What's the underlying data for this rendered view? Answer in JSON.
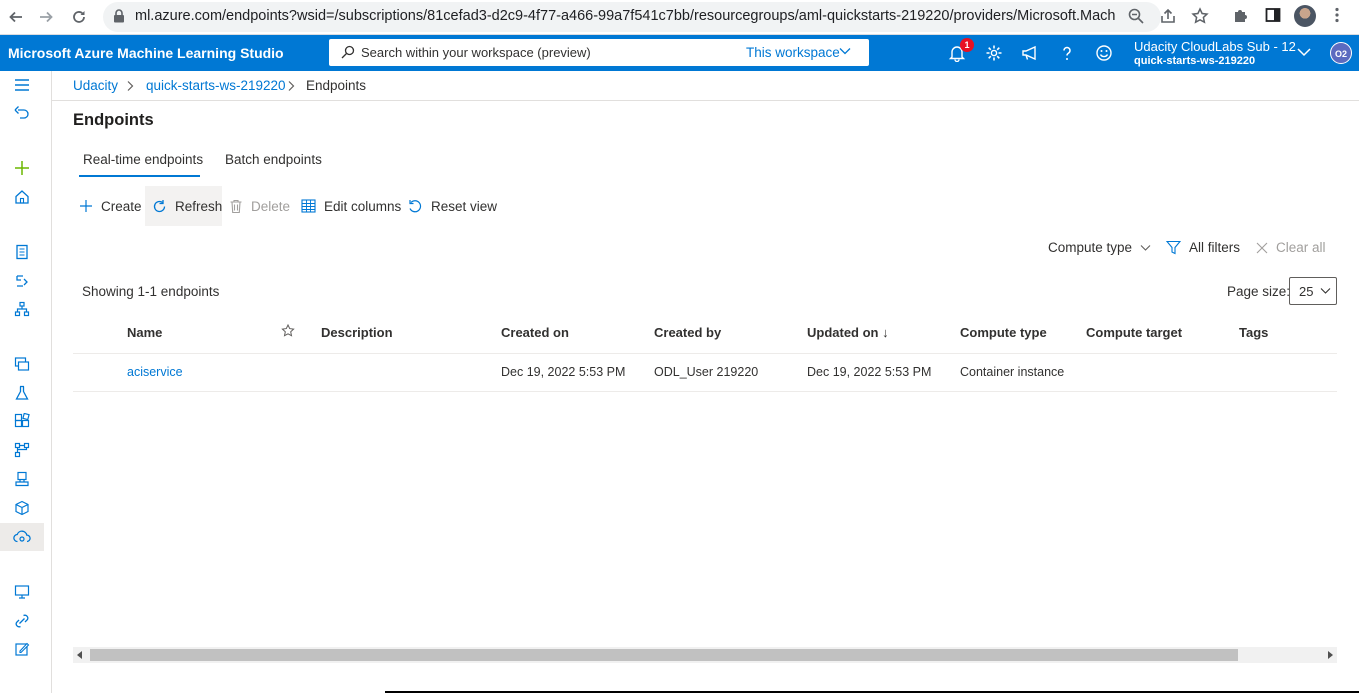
{
  "browser": {
    "url": "ml.azure.com/endpoints?wsid=/subscriptions/81cefad3-d2c9-4f77-a466-99a7f541c7bb/resourcegroups/aml-quickstarts-219220/providers/Microsoft.Machin..."
  },
  "topbar": {
    "brand": "Microsoft Azure Machine Learning Studio",
    "search_placeholder": "Search within your workspace (preview)",
    "search_scope": "This workspace",
    "notification_count": "1",
    "account_name": "Udacity CloudLabs Sub - 12",
    "workspace_name": "quick-starts-ws-219220",
    "avatar_initials": "O2",
    "accent_color": "#0078d4"
  },
  "breadcrumb": {
    "items": [
      "Udacity",
      "quick-starts-ws-219220",
      "Endpoints"
    ]
  },
  "page": {
    "title": "Endpoints",
    "tabs": [
      "Real-time endpoints",
      "Batch endpoints"
    ],
    "active_tab": "Real-time endpoints"
  },
  "toolbar": {
    "create": "Create",
    "refresh": "Refresh",
    "delete": "Delete",
    "edit_columns": "Edit columns",
    "reset_view": "Reset view"
  },
  "filters": {
    "compute_type": "Compute type",
    "all_filters": "All filters",
    "clear_all": "Clear all"
  },
  "list": {
    "showing": "Showing 1-1 endpoints",
    "page_size_label": "Page size:",
    "page_size": "25"
  },
  "table": {
    "columns": [
      "Name",
      "Description",
      "Created on",
      "Created by",
      "Updated on ↓",
      "Compute type",
      "Compute target",
      "Tags"
    ],
    "rows": [
      {
        "name": "aciservice",
        "description": "",
        "created_on": "Dec 19, 2022 5:53 PM",
        "created_by": "ODL_User 219220",
        "updated_on": "Dec 19, 2022 5:53 PM",
        "compute_type": "Container instance",
        "compute_target": "",
        "tags": ""
      }
    ]
  }
}
